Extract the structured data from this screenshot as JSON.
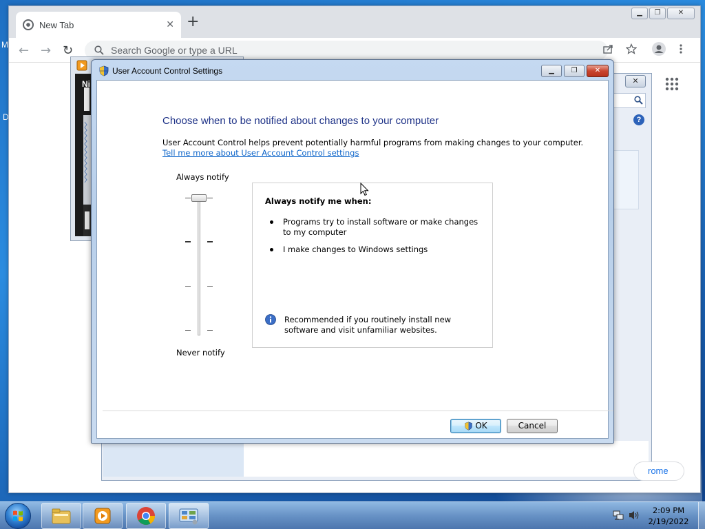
{
  "desktop": {
    "edge_letters": [
      "M",
      "D"
    ]
  },
  "chrome": {
    "tab_title": "New Tab",
    "tab_close": "✕",
    "new_tab": "+",
    "omnibox_placeholder": "Search Google or type a URL",
    "bottom_button_label": "rome",
    "icons": [
      "chrome-logo-icon",
      "back-icon",
      "forward-icon",
      "reload-icon",
      "search-icon",
      "share-icon",
      "star-icon",
      "profile-icon",
      "menu-icon",
      "apps-grid-icon"
    ]
  },
  "media_player": {
    "visible_text": "Ni"
  },
  "control_panel": {
    "close_label": "✕",
    "help_label": "?"
  },
  "uac": {
    "window_title": "User Account Control Settings",
    "heading": "Choose when to be notified about changes to your computer",
    "description": "User Account Control helps prevent potentially harmful programs from making changes to your computer.",
    "link": "Tell me more about User Account Control settings",
    "slider": {
      "top_label": "Always notify",
      "bottom_label": "Never notify",
      "levels": 4,
      "selected_level": 1
    },
    "info": {
      "heading": "Always notify me when:",
      "bullets": [
        "Programs try to install software or make changes to my computer",
        "I make changes to Windows settings"
      ],
      "recommendation": "Recommended if you routinely install new software and visit unfamiliar websites."
    },
    "buttons": {
      "ok": "OK",
      "cancel": "Cancel"
    },
    "colors": {
      "heading": "#1e3287",
      "link": "#0a63c9",
      "close_button": "#c9452f"
    }
  },
  "taskbar": {
    "time": "2:09 PM",
    "date": "2/19/2022",
    "pinned": [
      "explorer",
      "media-player",
      "chrome",
      "control-panel"
    ]
  }
}
